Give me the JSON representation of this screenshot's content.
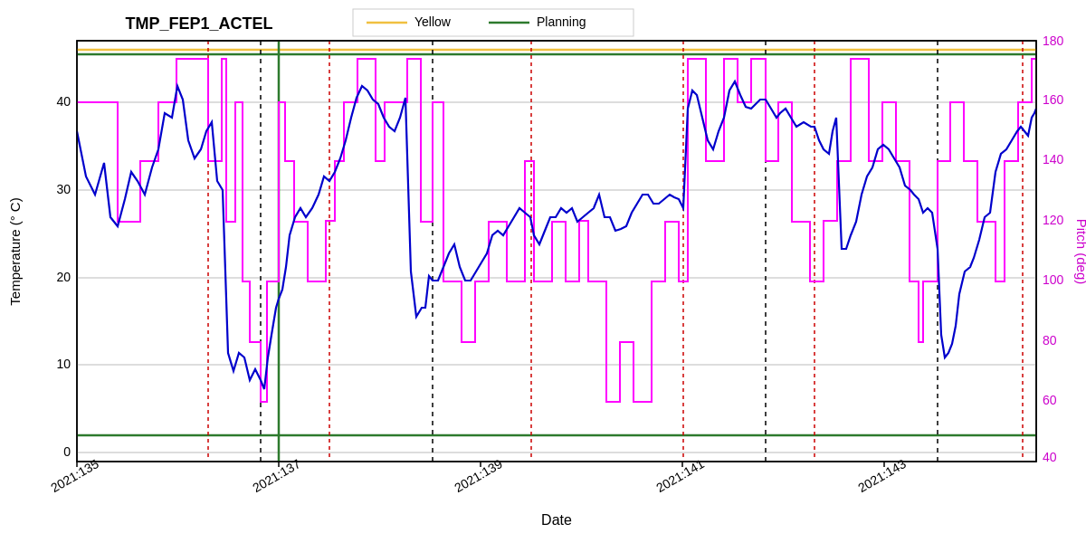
{
  "title": "TMP_FEP1_ACTEL",
  "legend": {
    "yellow_label": "Yellow",
    "planning_label": "Planning"
  },
  "axes": {
    "x_label": "Date",
    "y_left_label": "Temperature (° C)",
    "y_right_label": "Pitch (deg)",
    "x_ticks": [
      "2021:135",
      "2021:137",
      "2021:139",
      "2021:141",
      "2021:143"
    ],
    "y_left_ticks": [
      "0",
      "10",
      "20",
      "30",
      "40"
    ],
    "y_right_ticks": [
      "40",
      "60",
      "80",
      "100",
      "120",
      "140",
      "160",
      "180"
    ]
  },
  "colors": {
    "yellow_line": "#f0c040",
    "planning_line": "#2d7a2d",
    "blue_line": "#0000cc",
    "magenta_line": "#ff00ff",
    "red_dashed": "#cc0000",
    "black_dashed": "#000000",
    "grid": "#aaaaaa",
    "axis": "#000000"
  }
}
